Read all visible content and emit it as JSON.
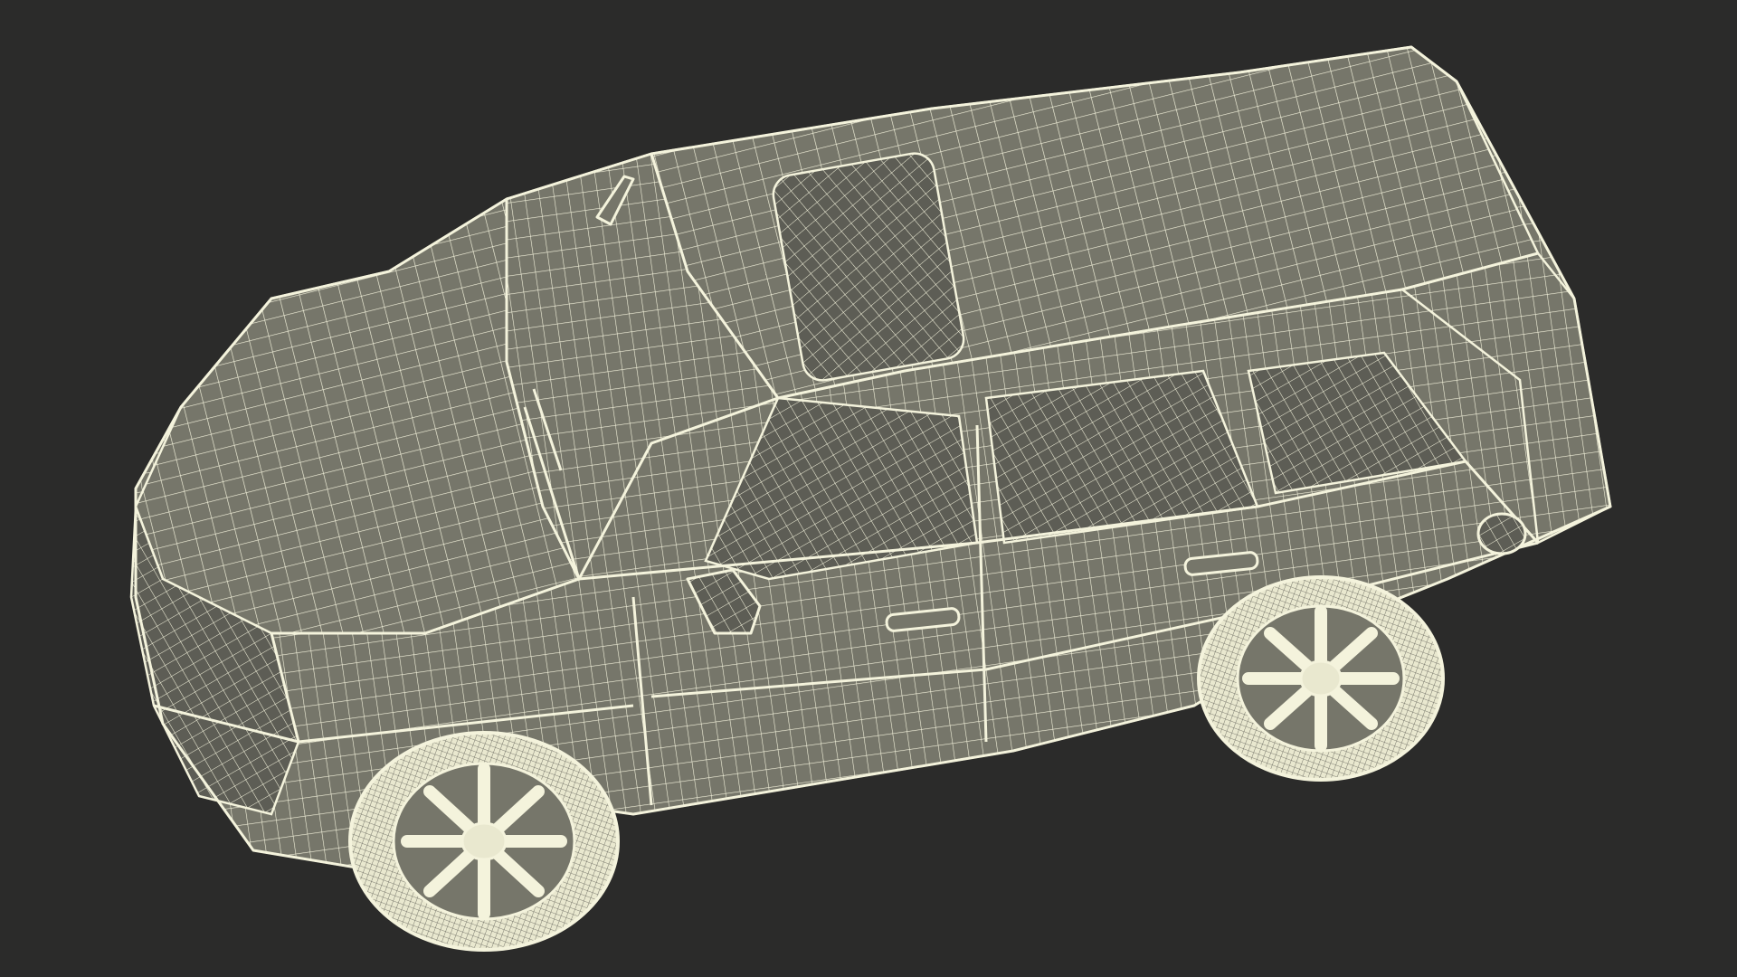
{
  "scene": {
    "subject": "suv-wireframe-model",
    "background_color": "#2b2b2a",
    "surface_color": "#76766a",
    "surface_shadow_color": "#5d5d55",
    "wire_color": "#f4f3dc",
    "wire_dense_color": "#e9e8cf"
  }
}
